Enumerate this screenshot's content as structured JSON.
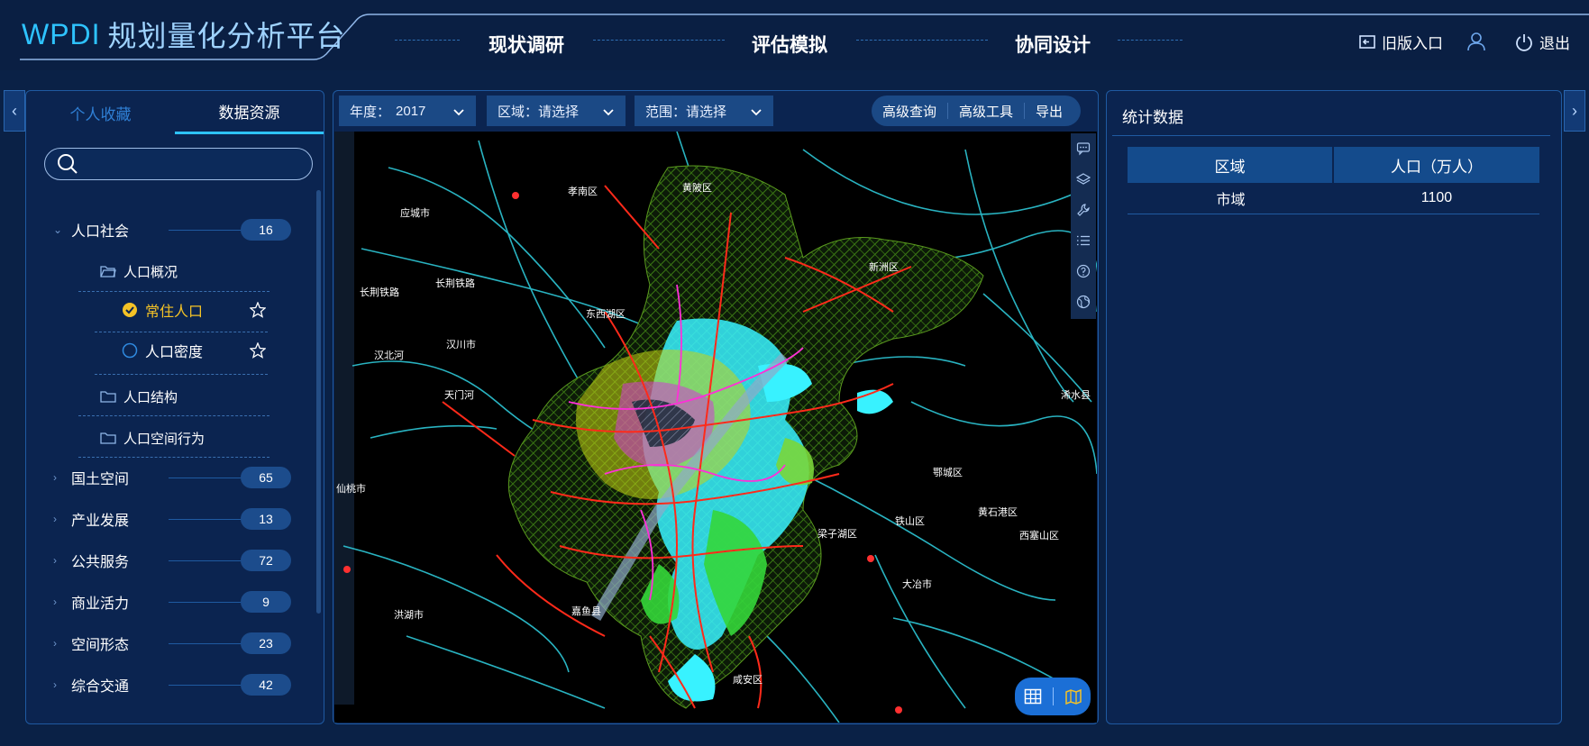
{
  "header": {
    "logo_short": "WPDI",
    "logo_name": "规划量化分析平台",
    "nav": [
      "现状调研",
      "评估模拟",
      "协同设计"
    ],
    "legacy_label": "旧版入口",
    "logout_label": "退出"
  },
  "left_panel": {
    "tabs": [
      "个人收藏",
      "数据资源"
    ],
    "search_placeholder": "",
    "categories": [
      {
        "label": "人口社会",
        "count": "16"
      },
      {
        "label": "国土空间",
        "count": "65"
      },
      {
        "label": "产业发展",
        "count": "13"
      },
      {
        "label": "公共服务",
        "count": "72"
      },
      {
        "label": "商业活力",
        "count": "9"
      },
      {
        "label": "空间形态",
        "count": "23"
      },
      {
        "label": "综合交通",
        "count": "42"
      }
    ],
    "subfolders": [
      "人口概况",
      "人口结构",
      "人口空间行为"
    ],
    "items": [
      {
        "label": "常住人口",
        "selected": true
      },
      {
        "label": "人口密度",
        "selected": false
      }
    ]
  },
  "map_toolbar": {
    "year_label": "年度：",
    "year_value": "2017",
    "area_label": "区域：请选择",
    "range_label": "范围：请选择",
    "buttons": [
      "高级查询",
      "高级工具",
      "导出"
    ]
  },
  "map_labels": [
    "孝南区",
    "应城市",
    "黄陂区",
    "新洲区",
    "东西湖区",
    "汉川市",
    "汉北河",
    "天门河",
    "长荆铁路",
    "长荆铁路",
    "仙桃市",
    "鄂城区",
    "黄石港区",
    "西塞山区",
    "铁山区",
    "梁子湖区",
    "大冶市",
    "洪湖市",
    "嘉鱼县",
    "咸安区",
    "浠水县"
  ],
  "stats": {
    "title": "统计数据",
    "columns": [
      "区域",
      "人口（万人）"
    ],
    "rows": [
      [
        "市域",
        "1100"
      ]
    ]
  },
  "colors": {
    "background": "#0a2146",
    "accent": "#2ec3ff",
    "selected": "#f4c226",
    "badge": "#1c4c8c"
  }
}
